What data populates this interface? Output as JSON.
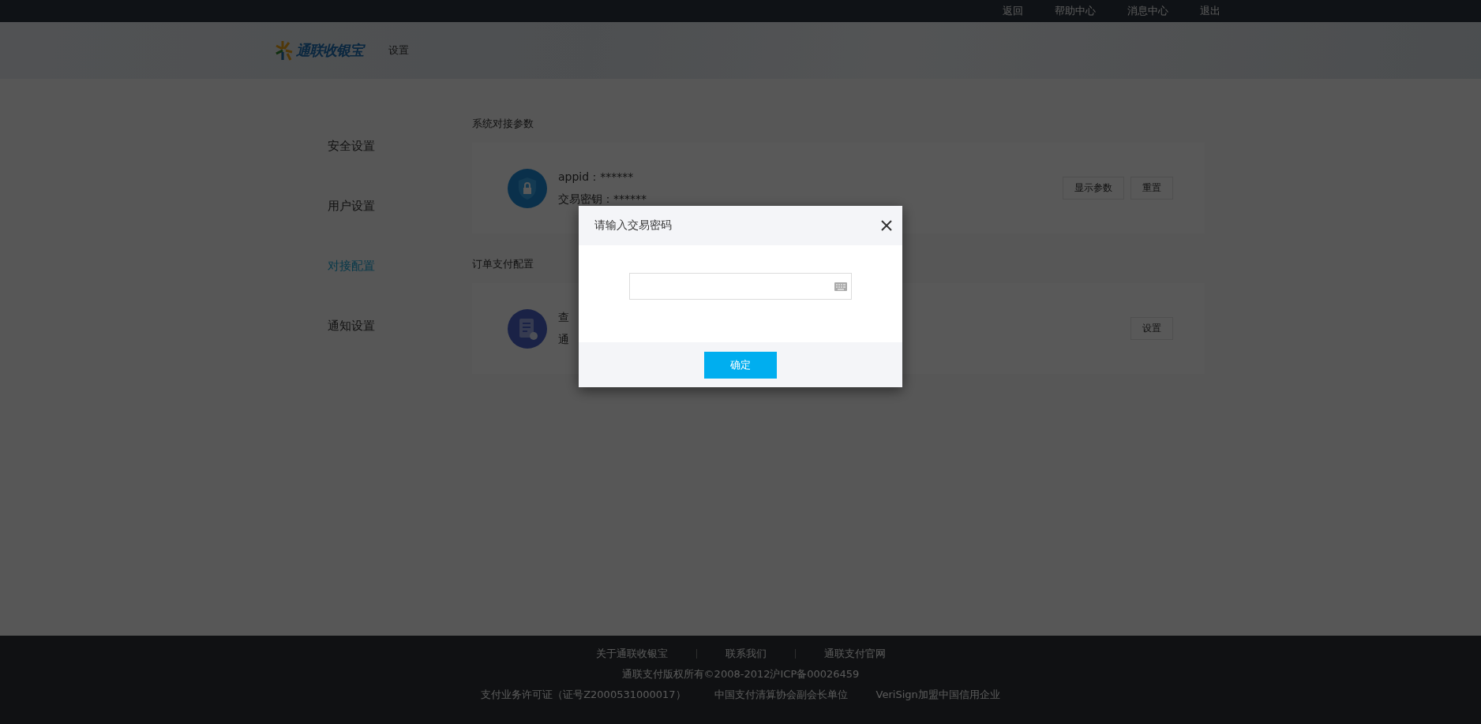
{
  "top_nav": {
    "links": [
      "返回",
      "帮助中心",
      "消息中心",
      "退出"
    ]
  },
  "header": {
    "logo_text": "通联收银宝",
    "title": "设置"
  },
  "sidebar": {
    "items": [
      {
        "label": "安全设置",
        "selected": false
      },
      {
        "label": "用户设置",
        "selected": false
      },
      {
        "label": "对接配置",
        "selected": true
      },
      {
        "label": "通知设置",
        "selected": false
      }
    ]
  },
  "sections": [
    {
      "title": "系统对接参数",
      "card": {
        "kind": "shield",
        "lines": [
          "appid：******",
          "交易密钥：******"
        ],
        "buttons": [
          "显示参数",
          "重置"
        ]
      }
    },
    {
      "title": "订单支付配置",
      "card": {
        "kind": "document",
        "lines": [
          "查",
          "通"
        ],
        "buttons": [
          "设置"
        ]
      }
    }
  ],
  "dialog": {
    "title": "请输入交易密码",
    "confirm": "确定"
  },
  "footer": {
    "links": [
      "关于通联收银宝",
      "联系我们",
      "通联支付官网"
    ],
    "copyright": "通联支付版权所有©2008-2012沪ICP备00026459",
    "credentials": [
      "支付业务许可证（证号Z2000531000017）",
      "中国支付清算协会副会长单位",
      "VeriSign加盟中国信用企业"
    ]
  }
}
